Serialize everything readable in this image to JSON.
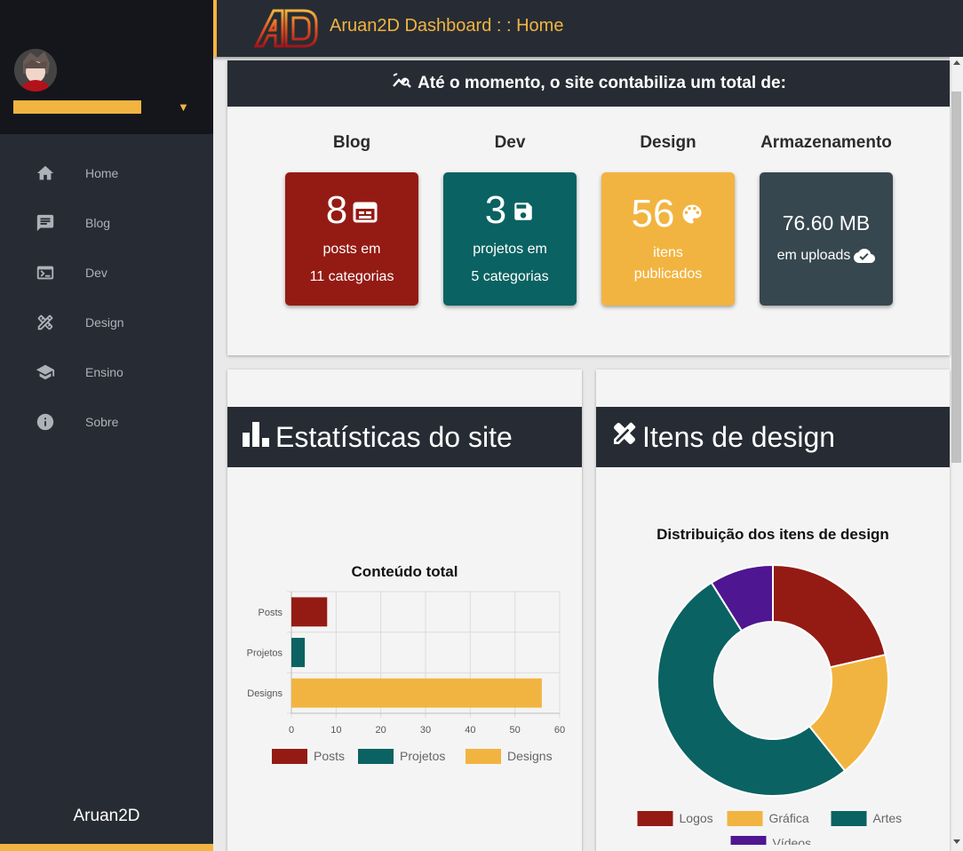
{
  "header": {
    "title": "Aruan2D Dashboard : : Home",
    "logo": "AD"
  },
  "sidebar": {
    "items": [
      {
        "label": "Home",
        "icon": "home-icon"
      },
      {
        "label": "Blog",
        "icon": "chat-icon"
      },
      {
        "label": "Dev",
        "icon": "terminal-icon"
      },
      {
        "label": "Design",
        "icon": "design-tools-icon"
      },
      {
        "label": "Ensino",
        "icon": "school-icon"
      },
      {
        "label": "Sobre",
        "icon": "info-icon"
      }
    ],
    "footer": "Aruan2D"
  },
  "summary": {
    "heading": "Até o momento, o site contabiliza um total de:",
    "stats": [
      {
        "title": "Blog",
        "value": "8",
        "line1": "posts em",
        "line2": "11 categorias",
        "color": "#941b14"
      },
      {
        "title": "Dev",
        "value": "3",
        "line1": "projetos em",
        "line2": "5 categorias",
        "color": "#0b6262"
      },
      {
        "title": "Design",
        "value": "56",
        "line1": "itens",
        "line2": "publicados",
        "color": "#f2b440"
      },
      {
        "title": "Armazenamento",
        "value": "76.60 MB",
        "line1": "em uploads",
        "color": "#37474f"
      }
    ]
  },
  "panels": {
    "stats_title": "Estatísticas do site",
    "design_title": "Itens de design"
  },
  "chart_data": [
    {
      "type": "bar",
      "orientation": "horizontal",
      "title": "Conteúdo total",
      "categories": [
        "Posts",
        "Projetos",
        "Designs"
      ],
      "values": [
        8,
        3,
        56
      ],
      "colors": [
        "#941b14",
        "#0b6262",
        "#f2b440"
      ],
      "xlim": [
        0,
        60
      ],
      "xticks": [
        0,
        10,
        20,
        30,
        40,
        50,
        60
      ],
      "grid": true,
      "legend": [
        "Posts",
        "Projetos",
        "Designs"
      ],
      "legend_position": "bottom"
    },
    {
      "type": "pie",
      "donut": true,
      "title": "Distribuição dos itens de design",
      "labels": [
        "Logos",
        "Gráfica",
        "Artes",
        "Vídeos"
      ],
      "values": [
        12,
        10,
        29,
        5
      ],
      "colors": [
        "#941b14",
        "#f2b440",
        "#0b6262",
        "#4f1691"
      ],
      "legend_position": "bottom"
    }
  ]
}
